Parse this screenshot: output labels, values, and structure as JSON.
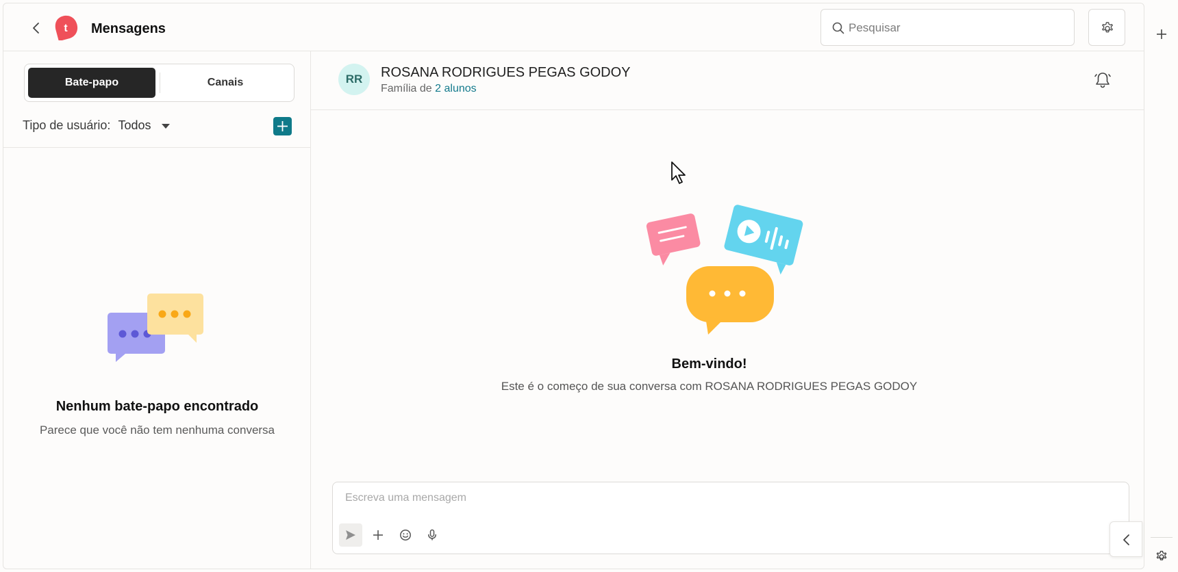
{
  "header": {
    "title": "Mensagens",
    "logo_letter": "t",
    "search_placeholder": "Pesquisar"
  },
  "sidebar": {
    "tabs": [
      {
        "label": "Bate-papo",
        "active": true
      },
      {
        "label": "Canais",
        "active": false
      }
    ],
    "filter_label": "Tipo de usuário:",
    "filter_value": "Todos",
    "empty_title": "Nenhum bate-papo encontrado",
    "empty_subtitle": "Parece que você não tem nenhuma conversa"
  },
  "chat": {
    "avatar_initials": "RR",
    "contact_name": "ROSANA RODRIGUES PEGAS GODOY",
    "family_prefix": "Família de",
    "family_link": "2 alunos",
    "welcome_title": "Bem-vindo!",
    "welcome_subtitle": "Este é o começo de sua conversa com ROSANA RODRIGUES PEGAS GODOY",
    "composer_placeholder": "Escreva uma mensagem"
  },
  "colors": {
    "accent": "#0f7a89",
    "logo": "#ef5059",
    "active_tab": "#262626",
    "avatar_bg": "#d3f3f0"
  },
  "icons": [
    "chevron-left-icon",
    "search-icon",
    "gear-icon",
    "plus-icon",
    "bell-icon",
    "send-icon",
    "emoji-icon",
    "microphone-icon"
  ]
}
